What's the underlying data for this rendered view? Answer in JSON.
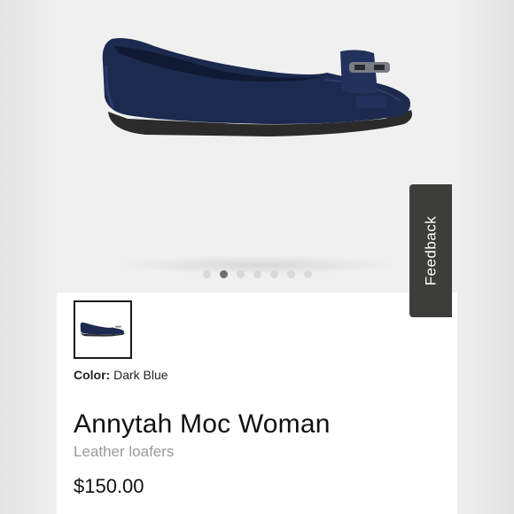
{
  "product": {
    "name": "Annytah Moc Woman",
    "category": "Leather loafers",
    "price": "$150.00",
    "color_label": "Color:",
    "color_value": "Dark Blue"
  },
  "gallery": {
    "total_images": 7,
    "active_index": 1
  },
  "feedback_tab": {
    "label": "Feedback"
  },
  "colors": {
    "shoe": "#1c2a4f",
    "sole": "#2b2b2b",
    "feedback_bg": "#3d3d3b",
    "dot_active": "#6f6f6f",
    "dot_inactive": "#d9d9d9"
  }
}
